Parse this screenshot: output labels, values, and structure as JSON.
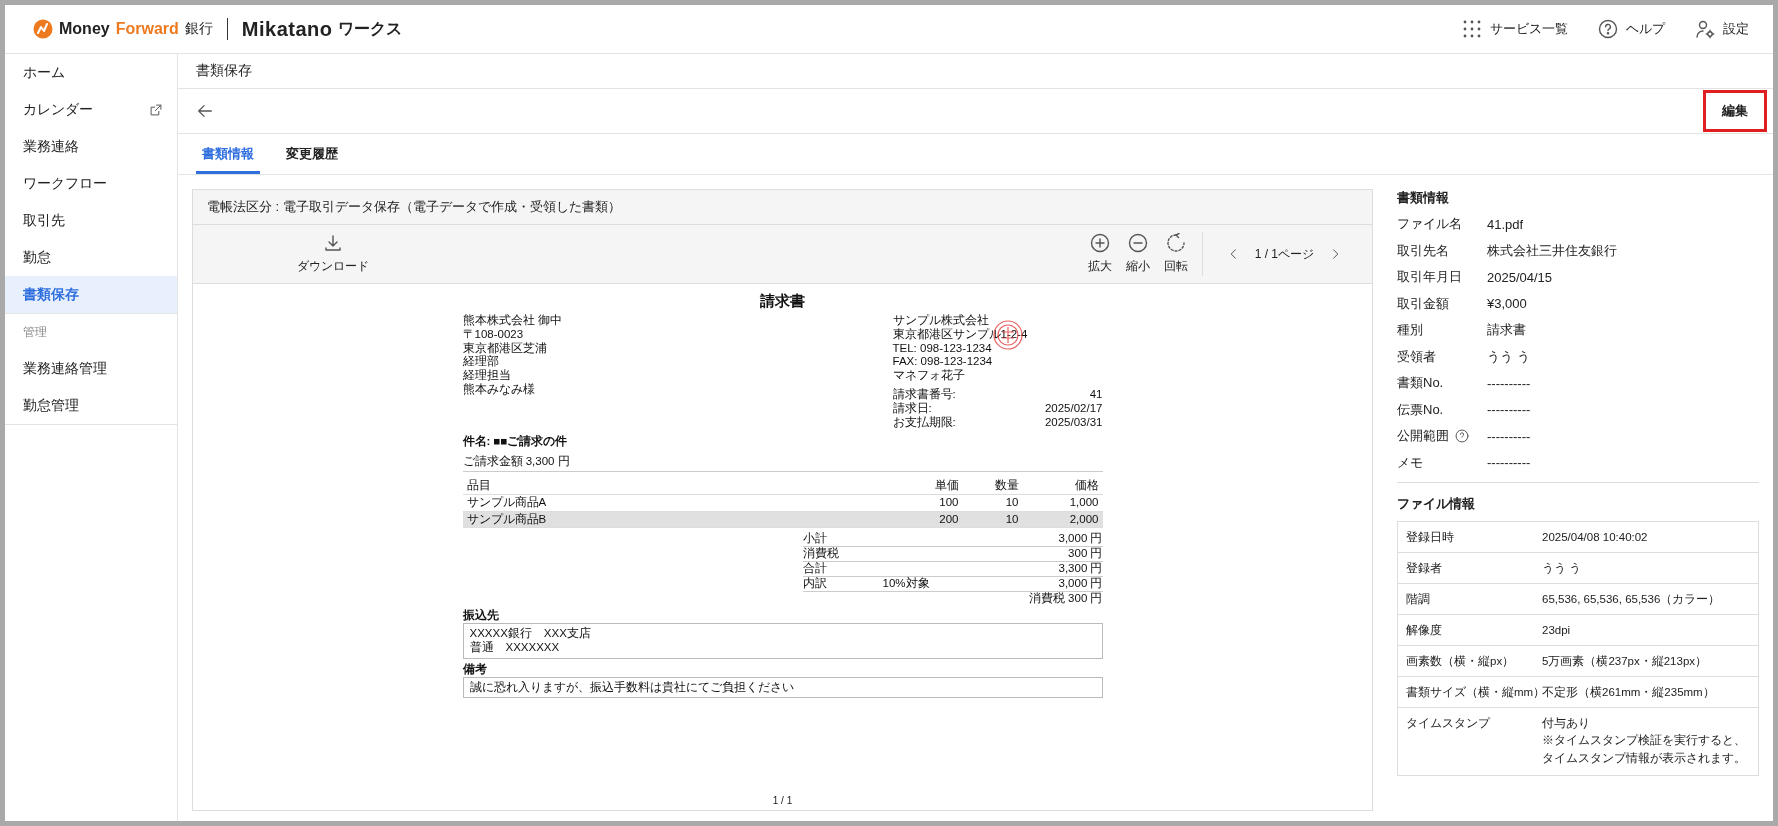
{
  "header": {
    "brand_1": "Money",
    "brand_2": "Forward",
    "brand_suffix": "銀行",
    "product": "Mikatano",
    "product_suffix": "ワークス",
    "actions": [
      {
        "kind": "grid",
        "label": "サービス一覧"
      },
      {
        "kind": "help",
        "label": "ヘルプ"
      },
      {
        "kind": "user-gear",
        "label": "設定"
      }
    ]
  },
  "sidebar": {
    "items": [
      {
        "kind": "item",
        "label": "ホーム",
        "selected": false,
        "external": false
      },
      {
        "kind": "item",
        "label": "カレンダー",
        "selected": false,
        "external": true
      },
      {
        "kind": "item",
        "label": "業務連絡",
        "selected": false,
        "external": false
      },
      {
        "kind": "item",
        "label": "ワークフロー",
        "selected": false,
        "external": false
      },
      {
        "kind": "item",
        "label": "取引先",
        "selected": false,
        "external": false
      },
      {
        "kind": "item",
        "label": "勤怠",
        "selected": false,
        "external": false
      },
      {
        "kind": "item",
        "label": "書類保存",
        "selected": true,
        "external": false
      },
      {
        "kind": "section",
        "label": "管理"
      },
      {
        "kind": "item",
        "label": "業務連絡管理",
        "selected": false,
        "external": false
      },
      {
        "kind": "item",
        "label": "勤怠管理",
        "selected": false,
        "external": false
      }
    ]
  },
  "page_title": "書類保存",
  "edit_button": {
    "label": "編集",
    "highlighted": true
  },
  "tabs": [
    {
      "label": "書類情報",
      "selected": true
    },
    {
      "label": "変更履歴",
      "selected": false
    }
  ],
  "preview": {
    "category": "電帳法区分 : 電子取引データ保存（電子データで作成・受領した書類）",
    "download": "ダウンロード",
    "tools": [
      {
        "kind": "zoom-in",
        "label": "拡大"
      },
      {
        "kind": "zoom-out",
        "label": "縮小"
      },
      {
        "kind": "rotate",
        "label": "回転"
      }
    ],
    "pager": "1 / 1ページ",
    "document": {
      "title": "請求書",
      "to_lines": [
        "熊本株式会社 御中",
        "〒108-0023",
        "東京都港区芝浦",
        "経理部",
        "経理担当",
        "熊本みなみ様"
      ],
      "from_lines": [
        "サンプル株式会社",
        "東京都港区サンプル1-2-4",
        "TEL: 098-123-1234",
        "FAX: 098-123-1234",
        "マネフォ花子"
      ],
      "meta": [
        {
          "label": "請求書番号:",
          "value": "41"
        },
        {
          "label": "請求日:",
          "value": "2025/02/17"
        },
        {
          "label": "お支払期限:",
          "value": "2025/03/31"
        }
      ],
      "subject": "件名: ■■ご請求の件",
      "amount": "ご請求金額 3,300 円",
      "columns": [
        "品目",
        "単価",
        "数量",
        "価格"
      ],
      "rows": [
        {
          "cells": [
            "サンプル商品A",
            "100",
            "10",
            "1,000"
          ],
          "shaded": false
        },
        {
          "cells": [
            "サンプル商品B",
            "200",
            "10",
            "2,000"
          ],
          "shaded": true
        }
      ],
      "totals": [
        {
          "label": "小計",
          "value": "3,000 円"
        },
        {
          "label": "消費税",
          "value": "300 円"
        },
        {
          "label": "合計",
          "value": "3,300 円"
        },
        {
          "label": "内訳",
          "note": "10%対象",
          "value": "3,000 円"
        }
      ],
      "tax_note": "消費税 300 円",
      "bank_label": "振込先",
      "bank_lines": [
        "XXXXX銀行　XXX支店",
        "普通　XXXXXXX"
      ],
      "remarks_label": "備考",
      "remarks": "誠に恐れ入りますが、振込手数料は貴社にてご負担ください"
    },
    "page_number": "1 / 1"
  },
  "doc_info": {
    "title": "書類情報",
    "rows": [
      {
        "label": "ファイル名",
        "value": "41.pdf",
        "help": false
      },
      {
        "label": "取引先名",
        "value": "株式会社三井住友銀行",
        "help": false
      },
      {
        "label": "取引年月日",
        "value": "2025/04/15",
        "help": false
      },
      {
        "label": "取引金額",
        "value": "¥3,000",
        "help": false
      },
      {
        "label": "種別",
        "value": "請求書",
        "help": false
      },
      {
        "label": "受領者",
        "value": "うう う",
        "help": false
      },
      {
        "label": "書類No.",
        "value": "----------",
        "help": false
      },
      {
        "label": "伝票No.",
        "value": "----------",
        "help": false
      },
      {
        "label": "公開範囲",
        "value": "----------",
        "help": true
      },
      {
        "label": "メモ",
        "value": "----------",
        "help": false
      }
    ]
  },
  "file_info": {
    "title": "ファイル情報",
    "rows": [
      {
        "label": "登録日時",
        "lines": [
          "2025/04/08 10:40:02"
        ]
      },
      {
        "label": "登録者",
        "lines": [
          "うう う"
        ]
      },
      {
        "label": "階調",
        "lines": [
          "65,536, 65,536, 65,536（カラー）"
        ]
      },
      {
        "label": "解像度",
        "lines": [
          "23dpi"
        ]
      },
      {
        "label": "画素数（横・縦px）",
        "lines": [
          "5万画素（横237px・縦213px）"
        ]
      },
      {
        "label": "書類サイズ（横・縦mm）",
        "lines": [
          "不定形（横261mm・縦235mm）"
        ]
      },
      {
        "label": "タイムスタンプ",
        "lines": [
          "付与あり",
          "※タイムスタンプ検証を実行すると、",
          "タイムスタンプ情報が表示されます。"
        ]
      }
    ]
  }
}
